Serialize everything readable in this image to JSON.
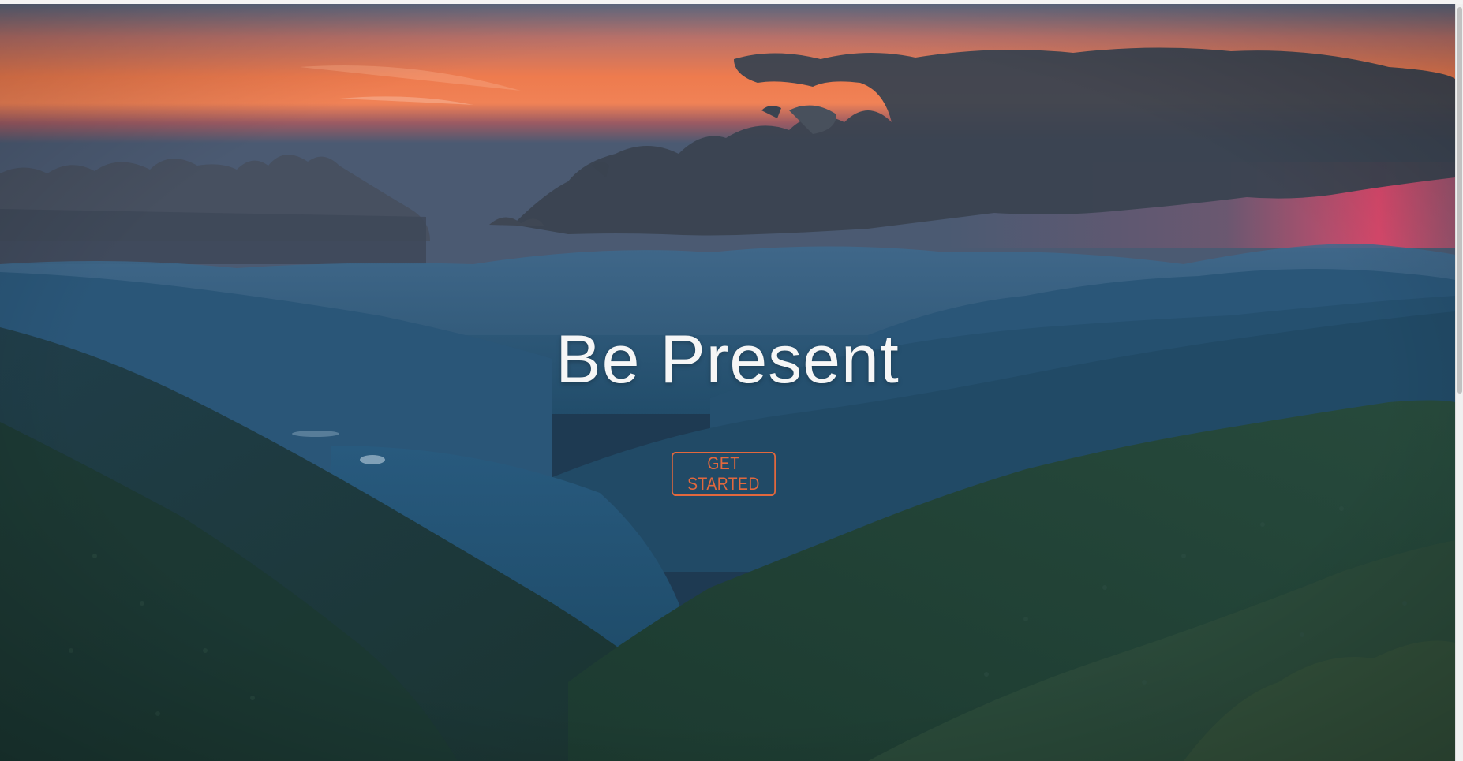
{
  "hero": {
    "title": "Be Present",
    "cta_label": "GET STARTED",
    "background": "sunset over layered blue mountain ridges with forested slopes"
  },
  "colors": {
    "accent": "#e2683d",
    "title_text": "#f6f6f6",
    "sky_orange": "#ee7b4e",
    "sky_pink": "#e84d6a",
    "clouds": "#3f4a56",
    "mountains_far": "#2f5a7d",
    "mountains_mid": "#1f4a66",
    "forest_near": "#1f3b34"
  },
  "icons": {
    "scrollbar": "vertical-scrollbar"
  }
}
